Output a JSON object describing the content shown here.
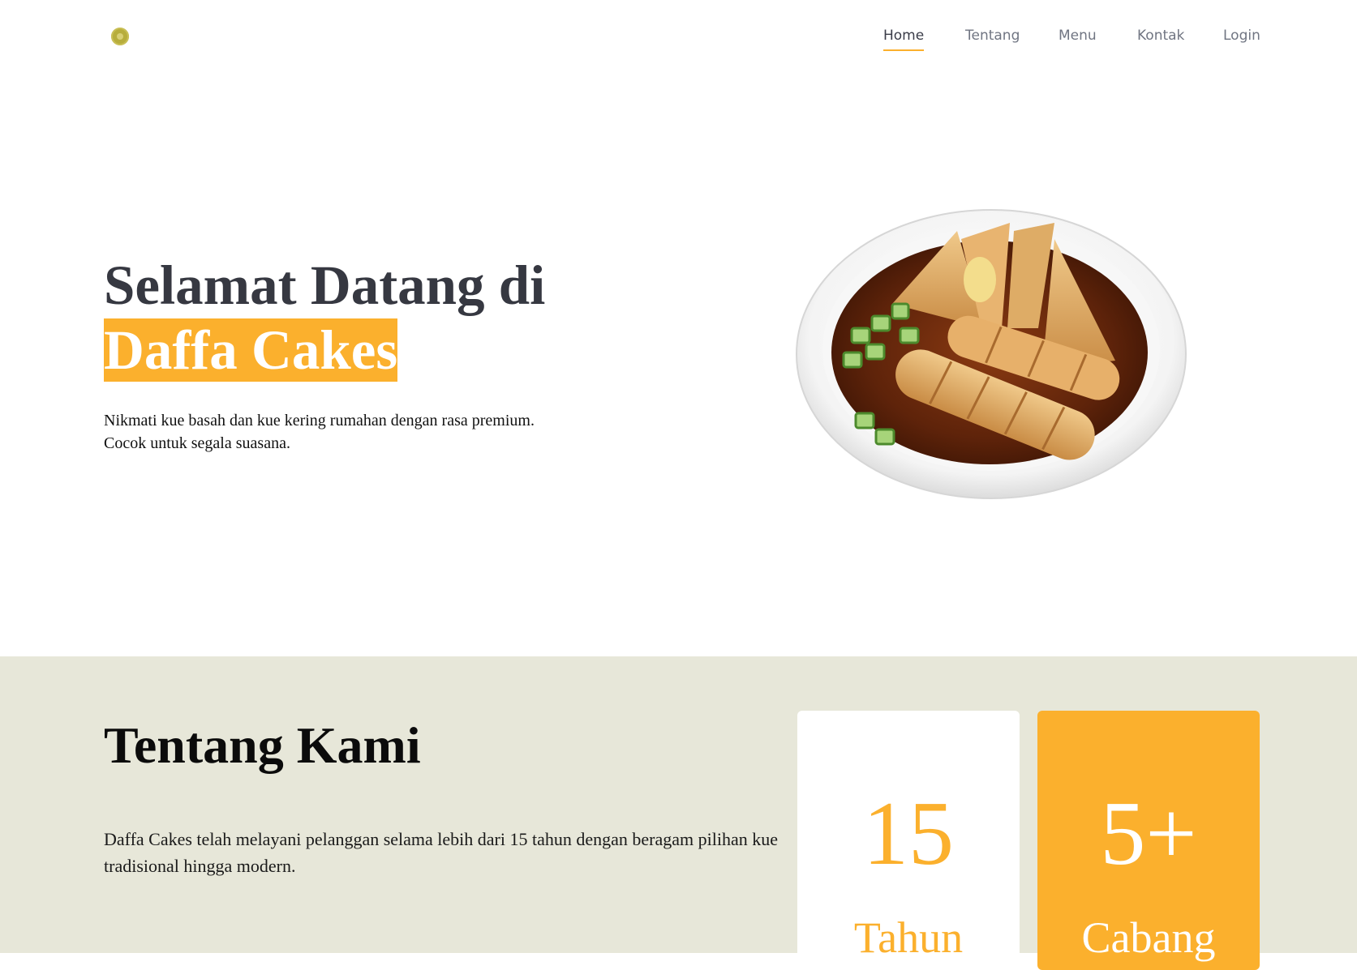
{
  "nav": {
    "logo_icon": "bakery-logo-icon",
    "items": [
      {
        "label": "Home",
        "active": true
      },
      {
        "label": "Tentang",
        "active": false
      },
      {
        "label": "Menu",
        "active": false
      },
      {
        "label": "Kontak",
        "active": false
      },
      {
        "label": "Login",
        "active": false
      }
    ]
  },
  "hero": {
    "title_line1": "Selamat Datang di",
    "title_highlight": "Daffa Cakes",
    "description_line1": "Nikmati kue basah dan kue kering rumahan dengan rasa premium.",
    "description_line2": "Cocok untuk segala suasana.",
    "image": "pempek-bowl-image"
  },
  "about": {
    "title": "Tentang Kami",
    "description": "Daffa Cakes telah melayani pelanggan selama lebih dari 15 tahun dengan beragam pilihan kue tradisional hingga modern.",
    "stats": [
      {
        "value": "15",
        "label": "Tahun"
      },
      {
        "value": "5+",
        "label": "Cabang"
      }
    ]
  },
  "colors": {
    "accent": "#fbb02d",
    "about_bg": "#e7e7d9",
    "heading": "#363841"
  }
}
